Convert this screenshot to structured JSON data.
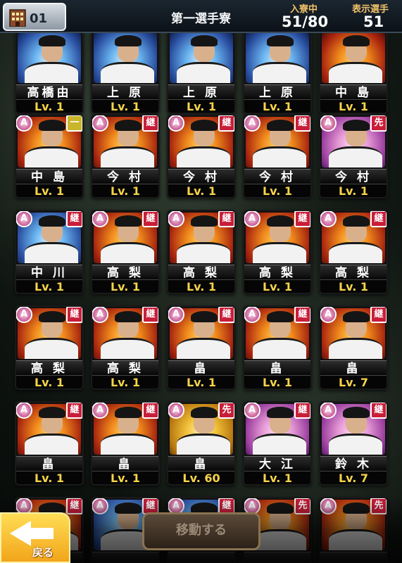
{
  "header": {
    "floor": "01",
    "title": "第一選手寮",
    "in_dorm_label": "入寮中",
    "in_dorm_value": "51/80",
    "shown_label": "表示選手",
    "shown_value": "51"
  },
  "rank_badge": "A",
  "rows": [
    [
      {
        "name": "高橋由",
        "level": "Lv. 1",
        "tag": "",
        "bg": "blue"
      },
      {
        "name": "上 原",
        "level": "Lv. 1",
        "tag": "",
        "bg": "blue"
      },
      {
        "name": "上 原",
        "level": "Lv. 1",
        "tag": "",
        "bg": "blue"
      },
      {
        "name": "上 原",
        "level": "Lv. 1",
        "tag": "",
        "bg": "blue"
      },
      {
        "name": "中 島",
        "level": "Lv. 1",
        "tag": "",
        "bg": "fire"
      }
    ],
    [
      {
        "name": "中 島",
        "level": "Lv. 1",
        "tag": "一",
        "bg": "fire"
      },
      {
        "name": "今 村",
        "level": "Lv. 1",
        "tag": "継",
        "bg": "fire"
      },
      {
        "name": "今 村",
        "level": "Lv. 1",
        "tag": "継",
        "bg": "fire"
      },
      {
        "name": "今 村",
        "level": "Lv. 1",
        "tag": "継",
        "bg": "fire"
      },
      {
        "name": "今 村",
        "level": "Lv. 1",
        "tag": "先",
        "bg": "pink"
      }
    ],
    [
      {
        "name": "中 川",
        "level": "Lv. 1",
        "tag": "継",
        "bg": "blue"
      },
      {
        "name": "高 梨",
        "level": "Lv. 1",
        "tag": "継",
        "bg": "fire"
      },
      {
        "name": "高 梨",
        "level": "Lv. 1",
        "tag": "継",
        "bg": "fire"
      },
      {
        "name": "高 梨",
        "level": "Lv. 1",
        "tag": "継",
        "bg": "fire"
      },
      {
        "name": "高 梨",
        "level": "Lv. 1",
        "tag": "継",
        "bg": "fire"
      }
    ],
    [
      {
        "name": "高 梨",
        "level": "Lv. 1",
        "tag": "継",
        "bg": "fire"
      },
      {
        "name": "高 梨",
        "level": "Lv. 1",
        "tag": "継",
        "bg": "fire"
      },
      {
        "name": "畠",
        "level": "Lv. 1",
        "tag": "継",
        "bg": "fire"
      },
      {
        "name": "畠",
        "level": "Lv. 1",
        "tag": "継",
        "bg": "fire"
      },
      {
        "name": "畠",
        "level": "Lv. 7",
        "tag": "継",
        "bg": "fire"
      }
    ],
    [
      {
        "name": "畠",
        "level": "Lv. 1",
        "tag": "継",
        "bg": "fire"
      },
      {
        "name": "畠",
        "level": "Lv. 1",
        "tag": "継",
        "bg": "fire"
      },
      {
        "name": "畠",
        "level": "Lv. 60",
        "tag": "先",
        "bg": "gold"
      },
      {
        "name": "大 江",
        "level": "Lv. 1",
        "tag": "継",
        "bg": "pink"
      },
      {
        "name": "鈴 木",
        "level": "Lv. 7",
        "tag": "継",
        "bg": "pink"
      }
    ],
    [
      {
        "name": "",
        "level": "",
        "tag": "継",
        "bg": "fire"
      },
      {
        "name": "",
        "level": "",
        "tag": "継",
        "bg": "blue"
      },
      {
        "name": "",
        "level": "",
        "tag": "継",
        "bg": "blue"
      },
      {
        "name": "",
        "level": "",
        "tag": "先",
        "bg": "fire"
      },
      {
        "name": "",
        "level": "",
        "tag": "先",
        "bg": "fire"
      }
    ]
  ],
  "buttons": {
    "back": "戻る",
    "move": "移動する"
  }
}
